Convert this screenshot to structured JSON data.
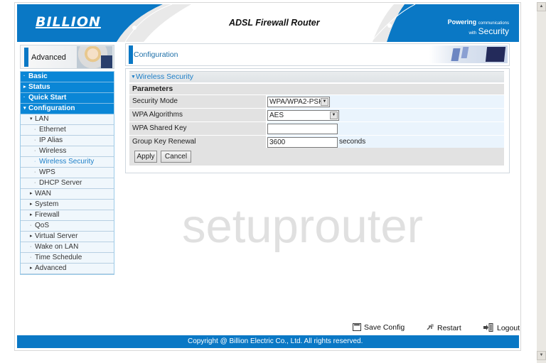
{
  "header": {
    "logo": "BILLION",
    "title": "ADSL Firewall Router",
    "tagline_bold": "Powering",
    "tagline_small": "communications",
    "tagline_with": "with",
    "tagline_big": "Security"
  },
  "sidebar": {
    "mode_label": "Advanced",
    "items": [
      {
        "label": "Basic",
        "level": "top",
        "glyph": "·"
      },
      {
        "label": "Status",
        "level": "top",
        "glyph": "▸"
      },
      {
        "label": "Quick Start",
        "level": "top",
        "glyph": "·"
      },
      {
        "label": "Configuration",
        "level": "top",
        "glyph": "▾"
      },
      {
        "label": "LAN",
        "level": "sub",
        "glyph": "▾"
      },
      {
        "label": "Ethernet",
        "level": "leaf",
        "glyph": "·"
      },
      {
        "label": "IP Alias",
        "level": "leaf",
        "glyph": "·"
      },
      {
        "label": "Wireless",
        "level": "leaf",
        "glyph": "·"
      },
      {
        "label": "Wireless Security",
        "level": "leaf",
        "glyph": "·",
        "active": true
      },
      {
        "label": "WPS",
        "level": "leaf",
        "glyph": "·"
      },
      {
        "label": "DHCP Server",
        "level": "leaf",
        "glyph": "·"
      },
      {
        "label": "WAN",
        "level": "sub",
        "glyph": "▸"
      },
      {
        "label": "System",
        "level": "sub",
        "glyph": "▸"
      },
      {
        "label": "Firewall",
        "level": "sub",
        "glyph": "▸"
      },
      {
        "label": "QoS",
        "level": "sub",
        "glyph": "·"
      },
      {
        "label": "Virtual Server",
        "level": "sub",
        "glyph": "▸"
      },
      {
        "label": "Wake on LAN",
        "level": "sub",
        "glyph": "·"
      },
      {
        "label": "Time Schedule",
        "level": "sub",
        "glyph": "·"
      },
      {
        "label": "Advanced",
        "level": "sub",
        "glyph": "▸"
      }
    ]
  },
  "content": {
    "section_title": "Configuration",
    "panel_title": "Wireless Security",
    "params_label": "Parameters",
    "fields": {
      "security_mode": {
        "label": "Security Mode",
        "value": "WPA/WPA2-PSK"
      },
      "wpa_algorithms": {
        "label": "WPA Algorithms",
        "value": "AES"
      },
      "wpa_shared_key": {
        "label": "WPA Shared Key",
        "value": ""
      },
      "group_key_renewal": {
        "label": "Group Key Renewal",
        "value": "3600",
        "unit": "seconds"
      }
    },
    "apply_label": "Apply",
    "cancel_label": "Cancel"
  },
  "watermark": "setuprouter",
  "footer": {
    "save_config": "Save Config",
    "restart": "Restart",
    "logout": "Logout",
    "copyright": "Copyright @ Billion Electric Co., Ltd. All rights reserved."
  },
  "colors": {
    "brand_blue": "#0a78c5",
    "nav_blue": "#0a86d6",
    "active_link": "#1d7fc8"
  }
}
